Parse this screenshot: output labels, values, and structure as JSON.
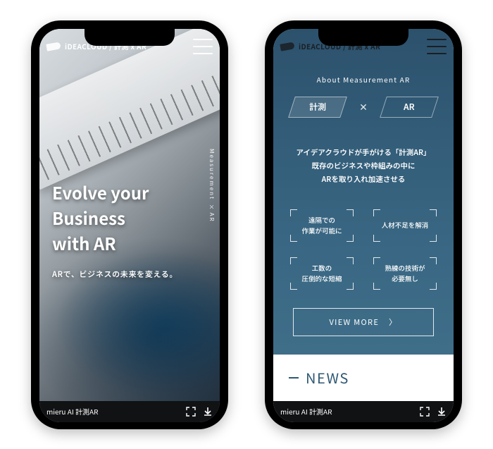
{
  "brand": {
    "logo_text": "iDEACLOUD / 計測 x AR"
  },
  "side_label": "Measurement × AR",
  "hero": {
    "headline_l1": "Evolve your",
    "headline_l2": "Business",
    "headline_l3": "with AR",
    "subcopy": "ARで、ビジネスの未来を変える。"
  },
  "about": {
    "section_title": "About  Measurement AR",
    "chip_left": "計測",
    "chip_x": "✕",
    "chip_right": "AR",
    "copy_l1": "アイデアクラウドが手がける「計測AR」",
    "copy_l2": "既存のビジネスや枠組みの中に",
    "copy_l3": "ARを取り入れ加速させる",
    "features": [
      {
        "l1": "遠隔での",
        "l2": "作業が可能に"
      },
      {
        "l1": "人材不足を解消",
        "l2": ""
      },
      {
        "l1": "工数の",
        "l2": "圧倒的な短縮"
      },
      {
        "l1": "熟練の技術が",
        "l2": "必要無し"
      }
    ],
    "view_more": "VIEW MORE"
  },
  "news": {
    "heading": "NEWS"
  },
  "bottom_bar": {
    "left_label": "mieru AI 計測AR"
  }
}
